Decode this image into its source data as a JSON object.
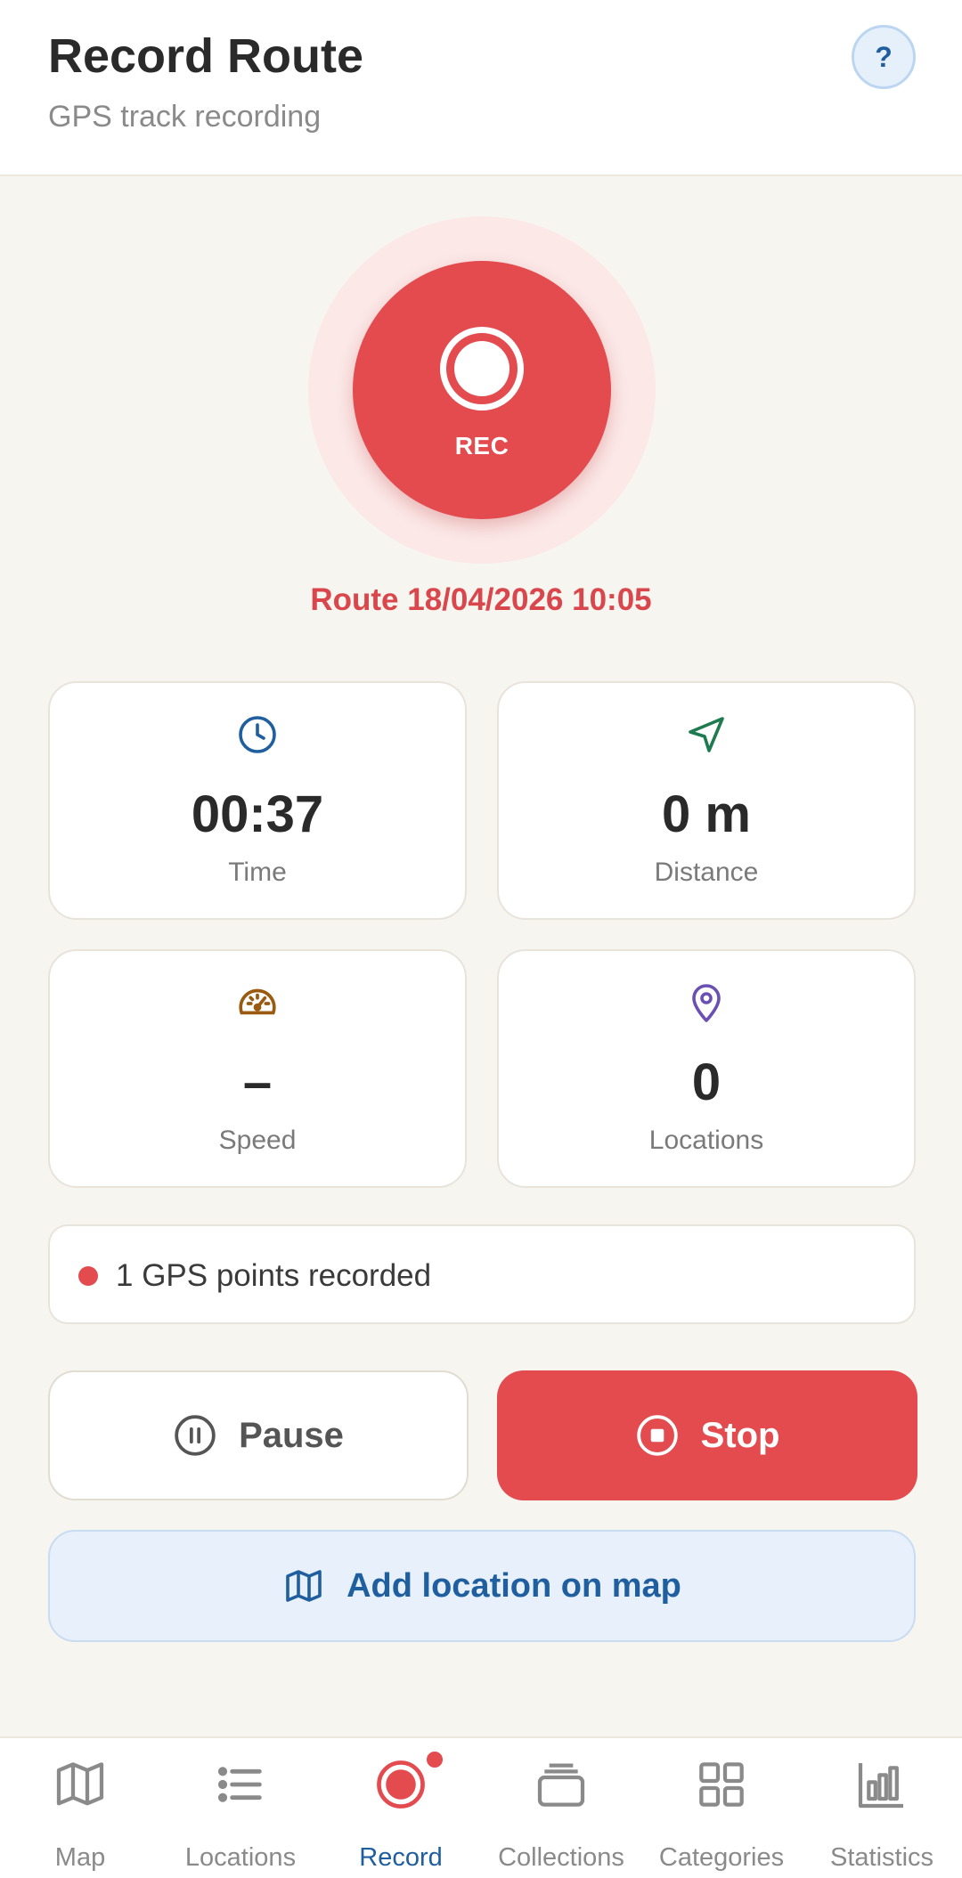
{
  "header": {
    "title": "Record Route",
    "subtitle": "GPS track recording",
    "help_label": "?"
  },
  "recorder": {
    "button_label": "REC",
    "route_name": "Route 18/04/2026 10:05"
  },
  "stats": [
    {
      "value": "00:37",
      "label": "Time",
      "icon": "clock-icon",
      "color": "#1f5f9f"
    },
    {
      "value": "0 m",
      "label": "Distance",
      "icon": "navigation-icon",
      "color": "#1e7a4f"
    },
    {
      "value": "–",
      "label": "Speed",
      "icon": "speedometer-icon",
      "color": "#9a5a10"
    },
    {
      "value": "0",
      "label": "Locations",
      "icon": "map-pin-icon",
      "color": "#6a4fb5"
    }
  ],
  "gps_status": {
    "text": "1 GPS points recorded",
    "dot_color": "#e34b4f"
  },
  "actions": {
    "pause_label": "Pause",
    "stop_label": "Stop",
    "add_location_label": "Add location on map"
  },
  "nav": {
    "items": [
      {
        "label": "Map",
        "icon": "map-icon"
      },
      {
        "label": "Locations",
        "icon": "list-icon"
      },
      {
        "label": "Record",
        "icon": "record-icon",
        "active": true
      },
      {
        "label": "Collections",
        "icon": "collections-icon"
      },
      {
        "label": "Categories",
        "icon": "grid-icon"
      },
      {
        "label": "Statistics",
        "icon": "bar-chart-icon"
      }
    ]
  },
  "colors": {
    "accent_red": "#e34b4f",
    "accent_blue": "#1f5f9f",
    "background": "#f7f5f0"
  }
}
